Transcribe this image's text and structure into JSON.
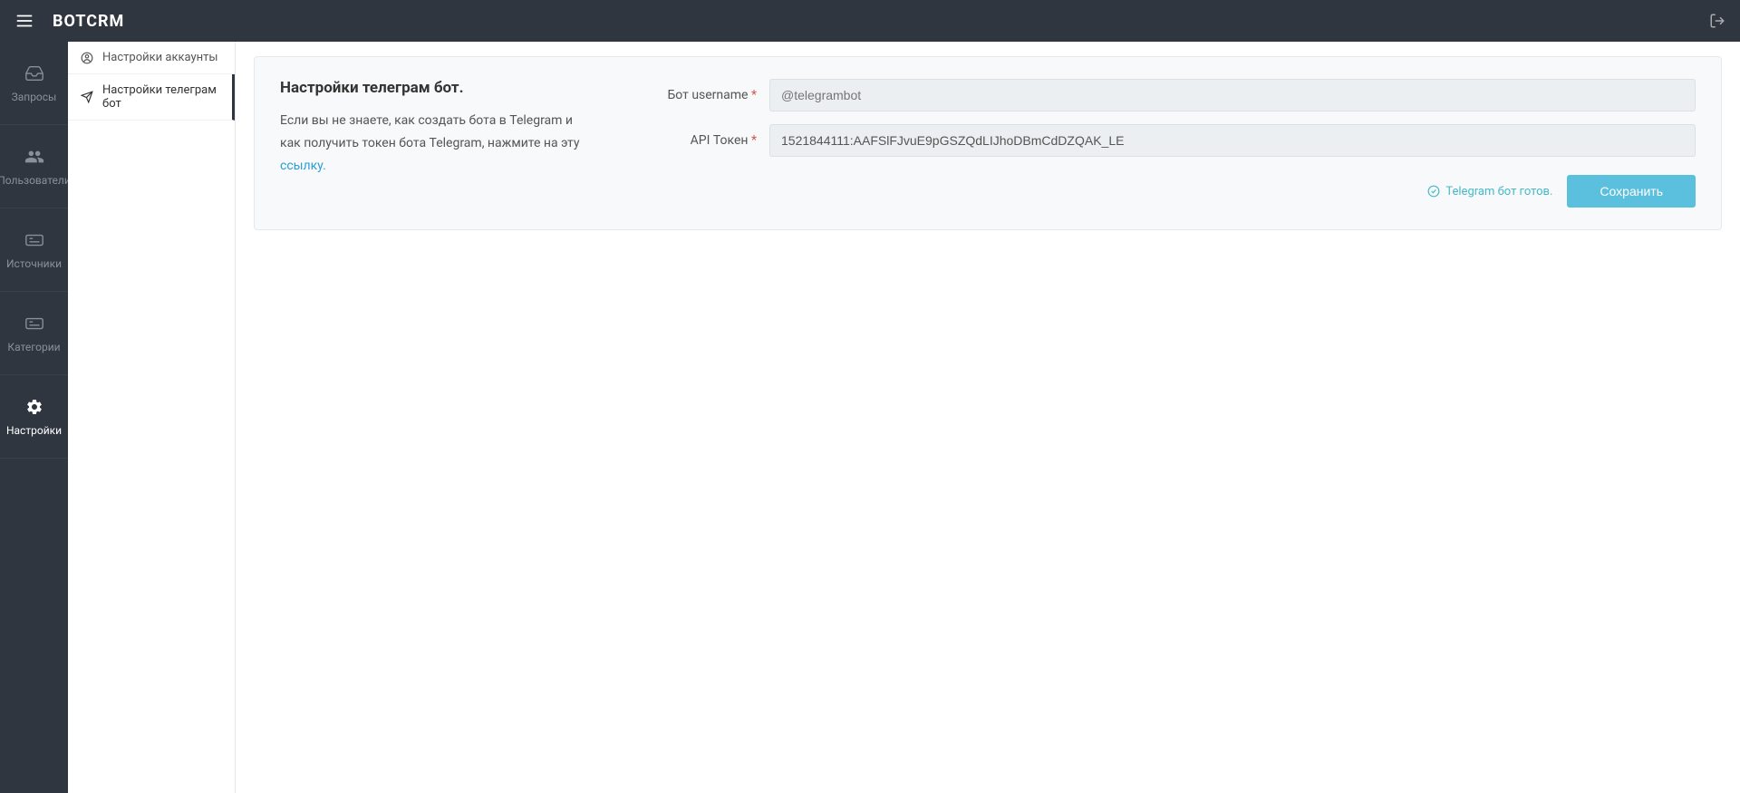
{
  "header": {
    "brand": "BOTCRM"
  },
  "sidebar": {
    "items": [
      {
        "label": "Запросы",
        "active": false
      },
      {
        "label": "Пользователи",
        "active": false
      },
      {
        "label": "Источники",
        "active": false
      },
      {
        "label": "Категории",
        "active": false
      },
      {
        "label": "Настройки",
        "active": true
      }
    ]
  },
  "subnav": {
    "items": [
      {
        "label": "Настройки аккаунты",
        "active": false
      },
      {
        "label": "Настройки телеграм бот",
        "active": true
      }
    ]
  },
  "page": {
    "title": "Настройки телеграм бот.",
    "desc_1": "Если вы не знаете, как создать бота в Telegram и как получить токен бота Telegram, нажмите на эту ",
    "link_text": "ссылку."
  },
  "form": {
    "username_label": "Бот username",
    "username_placeholder": "@telegrambot",
    "username_value": "",
    "token_label": "API Токен",
    "token_value": "1521844111:AAFSlFJvuE9pGSZQdLIJhoDBmCdDZQAK_LE",
    "required": "*",
    "status": "Telegram бот готов.",
    "save": "Сохранить"
  }
}
